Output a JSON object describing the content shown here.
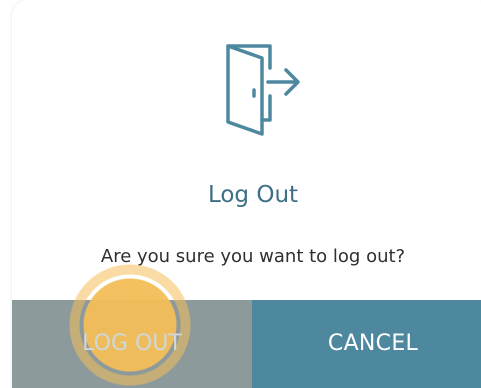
{
  "dialog": {
    "title": "Log Out",
    "message": "Are you sure you want to log out?",
    "icon": "logout-door-icon",
    "logout_label": "LOG OUT",
    "cancel_label": "CANCEL"
  },
  "colors": {
    "accent": "#3d6f86",
    "logout_button": "#8c9a9c",
    "cancel_button": "#4e889e",
    "touch_indicator": "#f4be58"
  }
}
